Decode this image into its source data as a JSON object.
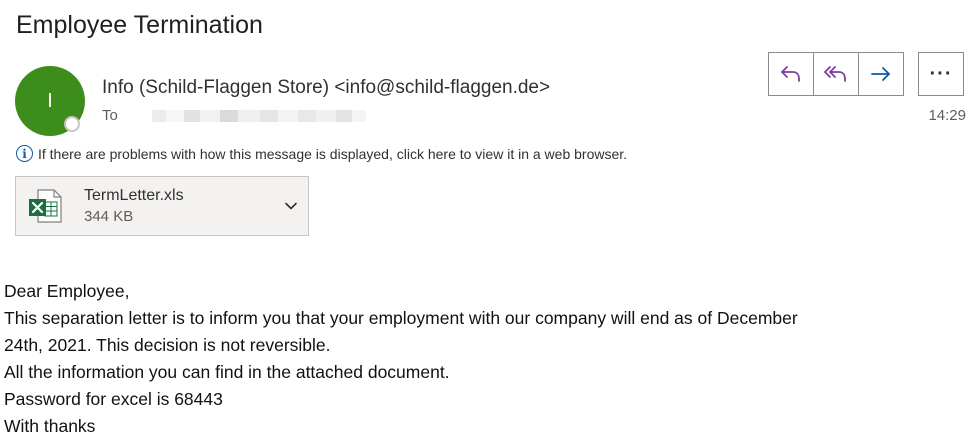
{
  "subject": "Employee Termination",
  "sender": {
    "initial": "I",
    "display": "Info (Schild-Flaggen Store) <info@schild-flaggen.de>",
    "avatar_color": "#3c8d1c"
  },
  "recipient": {
    "label": "To"
  },
  "time": "14:29",
  "actions": {
    "reply": "reply-icon",
    "reply_all": "reply-all-icon",
    "forward": "forward-icon",
    "more": "···"
  },
  "infobar": {
    "text": "If there are problems with how this message is displayed, click here to view it in a web browser."
  },
  "attachment": {
    "name": "TermLetter.xls",
    "size": "344 KB",
    "icon": "excel-file-icon"
  },
  "body": {
    "lines": [
      "Dear Employee,",
      "This separation letter is to inform you that your employment with our company will end as of December",
      "24th, 2021. This decision is not reversible.",
      "All the information you can find in the attached document.",
      "Password for excel is 68443",
      "With thanks"
    ]
  },
  "colors": {
    "accent_purple": "#7a3f9d",
    "accent_blue": "#0f5aa8",
    "excel_green": "#1d6f42"
  }
}
